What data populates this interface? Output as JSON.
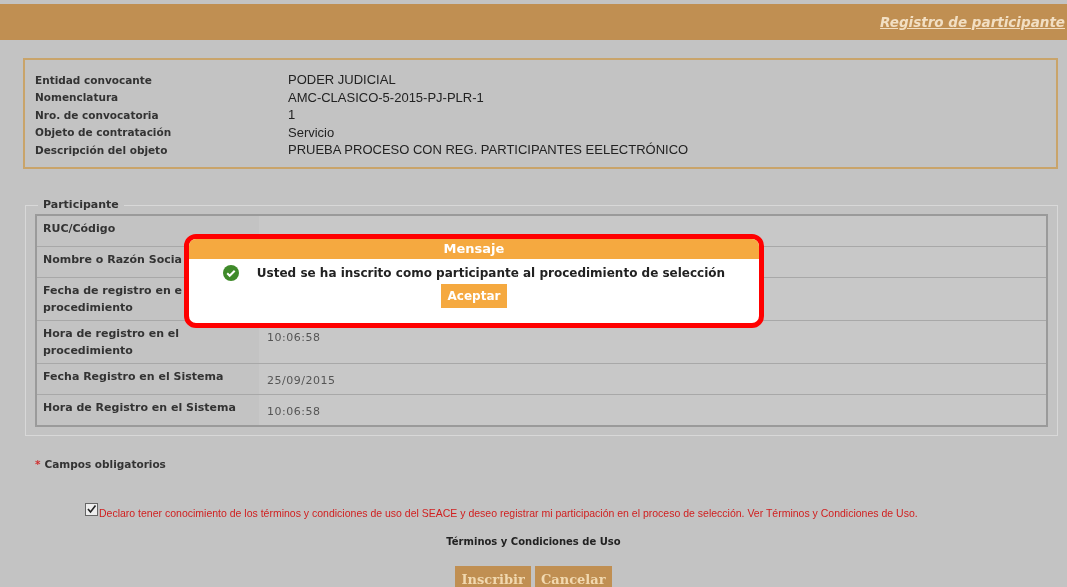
{
  "header": {
    "title": "Registro de participante"
  },
  "summary": [
    {
      "label": "Entidad convocante",
      "value": "PODER JUDICIAL"
    },
    {
      "label": "Nomenclatura",
      "value": "AMC-CLASICO-5-2015-PJ-PLR-1"
    },
    {
      "label": "Nro. de convocatoria",
      "value": "1"
    },
    {
      "label": "Objeto de contratación",
      "value": "Servicio"
    },
    {
      "label": "Descripción del objeto",
      "value": "PRUEBA PROCESO CON REG. PARTICIPANTES EELECTRÓNICO"
    }
  ],
  "participant": {
    "legend": "Participante",
    "rows": [
      {
        "label": "RUC/Código"
      },
      {
        "label": "Nombre o Razón Socia"
      },
      {
        "label": "Fecha de registro en e procedimiento"
      },
      {
        "label": "Hora de registro en el procedimiento",
        "value": "10:06:58"
      },
      {
        "label": "Fecha Registro en el Sistema",
        "value": "25/09/2015"
      },
      {
        "label": "Hora de Registro en el Sistema",
        "value": "10:06:58"
      }
    ]
  },
  "required_note": {
    "mark": "*",
    "text": "Campos obligatorios"
  },
  "agreement": {
    "checked": true,
    "text": "Declaro tener conocimiento de los términos y condiciones de uso del SEACE y deseo registrar mi participación en el proceso de selección. Ver Términos y Condiciones de Uso."
  },
  "terms_link": "Términos y Condiciones de Uso",
  "buttons": [
    "Inscribir",
    "Cancelar"
  ],
  "dialog": {
    "title": "Mensaje",
    "message": "Usted se ha inscrito como participante al procedimiento de selección",
    "button": "Aceptar"
  }
}
